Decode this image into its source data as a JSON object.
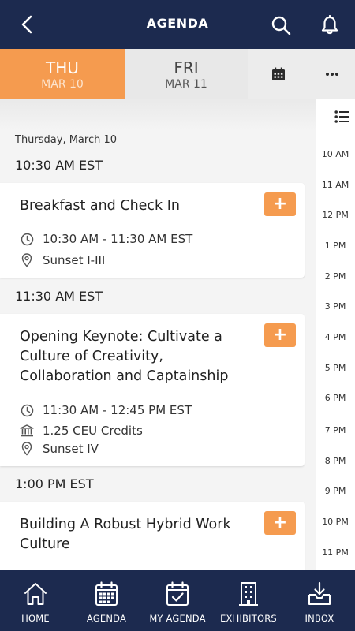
{
  "header": {
    "title": "AGENDA",
    "back_icon": "chevron-left-icon",
    "search_icon": "search-icon",
    "notification_icon": "bell-icon"
  },
  "day_tabs": [
    {
      "dow": "THU",
      "date": "MAR 10",
      "active": true
    },
    {
      "dow": "FRI",
      "date": "MAR 11",
      "active": false
    }
  ],
  "toolbar": {
    "calendar_icon": "calendar-icon",
    "more_icon": "more-horizontal-icon"
  },
  "agenda": {
    "day_heading": "Thursday, March 10",
    "groups": [
      {
        "time": "10:30 AM EST",
        "sessions": [
          {
            "title": "Breakfast and Check In",
            "time": "10:30 AM - 11:30 AM EST",
            "location": "Sunset I-III",
            "credits": ""
          }
        ]
      },
      {
        "time": "11:30 AM EST",
        "sessions": [
          {
            "title": "Opening Keynote: Cultivate a Culture of Creativity, Collaboration and Captainship",
            "time": "11:30 AM - 12:45 PM EST",
            "credits": "1.25 CEU Credits",
            "location": "Sunset IV"
          }
        ]
      },
      {
        "time": "1:00 PM EST",
        "sessions": [
          {
            "title": "Building A Robust Hybrid Work Culture",
            "time": "",
            "credits": "",
            "location": ""
          }
        ]
      }
    ],
    "add_label": "+"
  },
  "timeline": {
    "list_icon": "list-icon",
    "hours": [
      "10 AM",
      "11 AM",
      "12 PM",
      "1 PM",
      "2 PM",
      "3 PM",
      "4 PM",
      "5 PM",
      "6 PM",
      "7 PM",
      "8 PM",
      "9 PM",
      "10 PM",
      "11 PM"
    ]
  },
  "bottom_nav": [
    {
      "label": "HOME",
      "icon": "home-icon"
    },
    {
      "label": "AGENDA",
      "icon": "calendar-grid-icon"
    },
    {
      "label": "MY AGENDA",
      "icon": "calendar-check-icon"
    },
    {
      "label": "EXHIBITORS",
      "icon": "building-icon"
    },
    {
      "label": "INBOX",
      "icon": "inbox-download-icon"
    }
  ],
  "colors": {
    "navy": "#1c2a4f",
    "accent": "#f59b4f"
  }
}
